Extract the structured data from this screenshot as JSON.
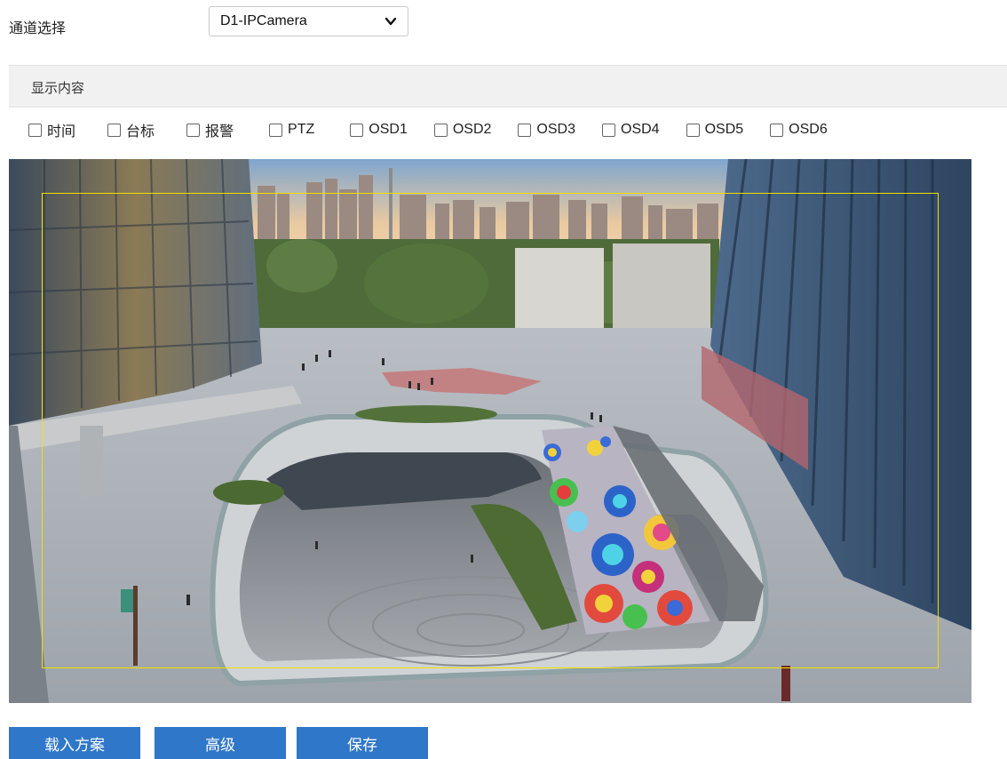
{
  "channel": {
    "label": "通道选择",
    "selected": "D1-IPCamera"
  },
  "display_section": {
    "title": "显示内容"
  },
  "checkboxes": [
    {
      "label": "时间",
      "checked": false
    },
    {
      "label": "台标",
      "checked": false
    },
    {
      "label": "报警",
      "checked": false
    },
    {
      "label": "PTZ",
      "checked": false
    },
    {
      "label": "OSD1",
      "checked": false
    },
    {
      "label": "OSD2",
      "checked": false
    },
    {
      "label": "OSD3",
      "checked": false
    },
    {
      "label": "OSD4",
      "checked": false
    },
    {
      "label": "OSD5",
      "checked": false
    },
    {
      "label": "OSD6",
      "checked": false
    }
  ],
  "buttons": {
    "load": "载入方案",
    "advanced": "高级",
    "save": "保存"
  },
  "colors": {
    "button": "#2f77c9",
    "osd_frame": "#f0e000"
  }
}
